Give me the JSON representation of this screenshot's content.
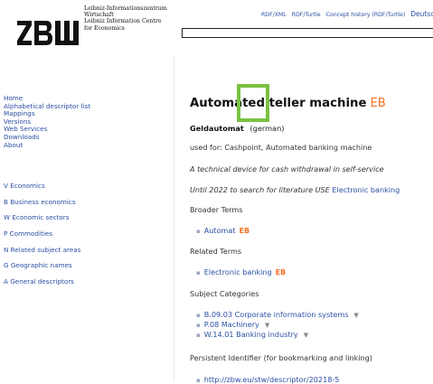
{
  "header": {
    "logo_lines": [
      "Leibniz-Informationszentrum",
      "Wirtschaft",
      "Leibniz Information Centre",
      "for Economics"
    ],
    "links": [
      "RDF/XML",
      "RDF/Turtle",
      "Concept history (RDF/Turtle)"
    ],
    "language": "Deutsch",
    "search_value": ""
  },
  "sidebar": {
    "nav": [
      "Home",
      "Alphabetical descriptor list",
      "Mappings",
      "Versions",
      "Web Services",
      "Downloads",
      "About"
    ],
    "thesaurus": [
      "V Economics",
      "B Business economics",
      "W Economic sectors",
      "P Commodities",
      "N Related subject areas",
      "G Geographic names",
      "A General descriptors"
    ]
  },
  "concept": {
    "title": "Automated teller machine",
    "badge": "EB",
    "german_label": "Geldautomat",
    "german_suffix": "(german)",
    "used_for": "used for: Cashpoint, Automated banking machine",
    "definition": "A technical device for cash withdrawal in self-service",
    "history_text": "Until 2022 to search for literature USE",
    "history_link": "Electronic banking",
    "broader_heading": "Broader Terms",
    "broader": [
      {
        "label": "Automat",
        "badge": "EB"
      }
    ],
    "related_heading": "Related Terms",
    "related": [
      {
        "label": "Electronic banking",
        "badge": "EB"
      }
    ],
    "categories_heading": "Subject Categories",
    "categories": [
      "B.09.03 Corporate information systems",
      "P.08 Machinery",
      "W.14.01 Banking industry"
    ],
    "pid_heading": "Persistent Identifier (for bookmarking and linking)",
    "pid_partial": "http://zbw.eu/stw/descriptor/20218-5"
  },
  "colors": {
    "link": "#2a4fa5",
    "badge": "#f07020",
    "highlight": "#7ac143"
  }
}
